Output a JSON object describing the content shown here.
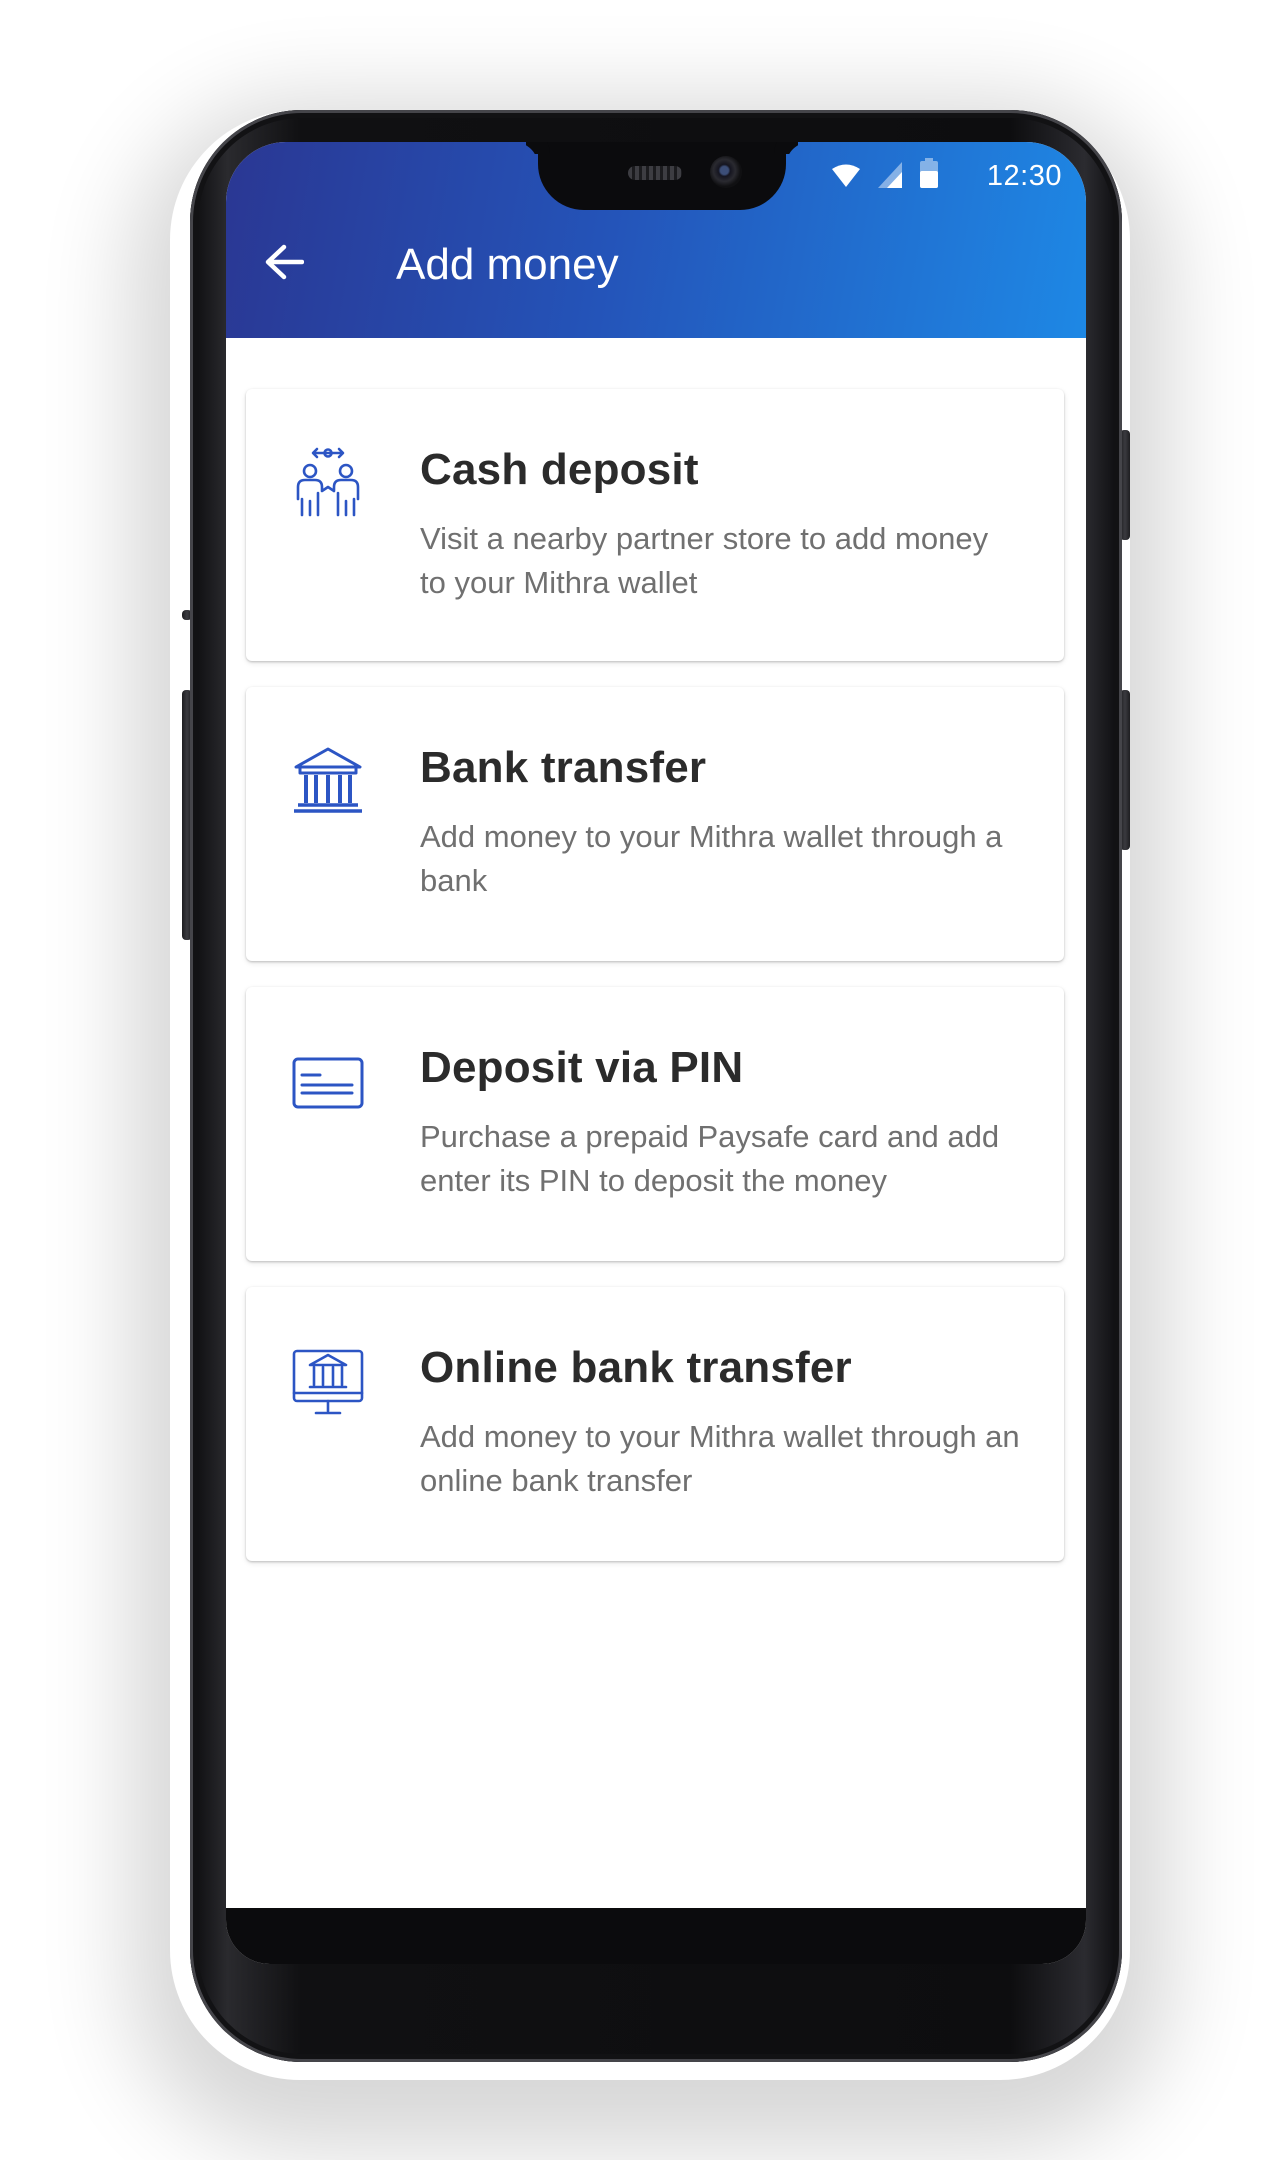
{
  "status_bar": {
    "time": "12:30",
    "icons": [
      "wifi-icon",
      "signal-icon",
      "battery-icon"
    ]
  },
  "app_bar": {
    "back_icon": "arrow-left-icon",
    "title": "Add money"
  },
  "colors": {
    "header_gradient_start": "#2a3793",
    "header_gradient_end": "#1e88e5",
    "icon_blue": "#2c55c4",
    "title_text": "#2b2b2b",
    "description_text": "#707070"
  },
  "options": [
    {
      "icon": "people-exchange-icon",
      "title": "Cash deposit",
      "description": "Visit a nearby partner store to add money to your Mithra wallet"
    },
    {
      "icon": "bank-icon",
      "title": "Bank transfer",
      "description": "Add money to your Mithra wallet through a bank"
    },
    {
      "icon": "card-icon",
      "title": "Deposit via PIN",
      "description": "Purchase a prepaid Paysafe card and add enter its PIN to deposit the money"
    },
    {
      "icon": "online-bank-icon",
      "title": "Online bank transfer",
      "description": "Add money to your Mithra wallet through an online bank transfer"
    }
  ]
}
